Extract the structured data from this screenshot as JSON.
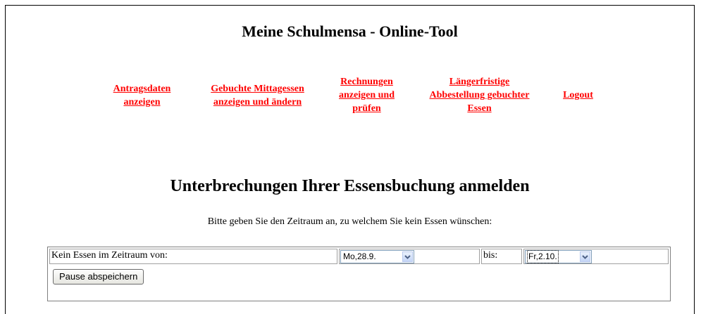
{
  "page": {
    "title": "Meine Schulmensa - Online-Tool",
    "heading": "Unterbrechungen Ihrer Essensbuchung anmelden",
    "instruction": "Bitte geben Sie den Zeitraum an, zu welchem Sie kein Essen wünschen:"
  },
  "nav": {
    "items": [
      {
        "lines": [
          "Antragsdaten",
          "anzeigen"
        ]
      },
      {
        "lines": [
          "Gebuchte Mittagessen",
          "anzeigen und ändern"
        ]
      },
      {
        "lines": [
          "Rechnungen",
          "anzeigen und",
          "prüfen"
        ]
      },
      {
        "lines": [
          "Längerfristige",
          "Abbestellung gebuchter",
          "Essen"
        ]
      },
      {
        "lines": [
          "Logout"
        ]
      }
    ],
    "color": "#ff0000"
  },
  "form": {
    "from_label": "Kein Essen im Zeitraum von:",
    "from_value": "Mo,28.9.",
    "to_label": "bis:",
    "to_value": "Fr,2.10.",
    "save_button": "Pause abspeichern"
  }
}
